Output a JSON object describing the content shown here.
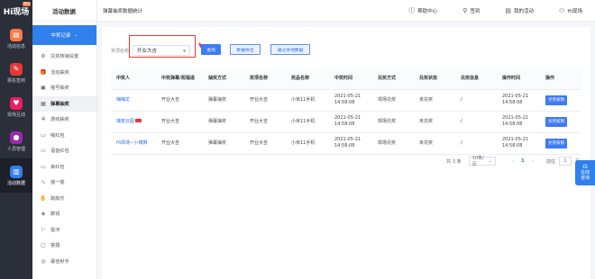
{
  "brand": {
    "logo_text": "Hi现场",
    "badge": "测试"
  },
  "rail": [
    {
      "label": "活动信息",
      "icon": "briefcase-icon",
      "color": "#ff7a45"
    },
    {
      "label": "报名签到",
      "icon": "checkin-icon",
      "color": "#e53935"
    },
    {
      "label": "现场互动",
      "icon": "interaction-icon",
      "color": "#e91e63"
    },
    {
      "label": "人员管理",
      "icon": "user-icon",
      "color": "#9c27b0"
    },
    {
      "label": "活动数据",
      "icon": "chart-icon",
      "color": "#2f80ed"
    }
  ],
  "sidebar": {
    "title": "活动数据",
    "group": "中奖记录",
    "items": [
      {
        "label": "兑奖核销设置",
        "icon": "settings-icon"
      },
      {
        "label": "活动抽奖",
        "icon": "gift-icon"
      },
      {
        "label": "摇号抽奖",
        "icon": "dice-icon"
      },
      {
        "label": "弹幕抽奖",
        "icon": "danmaku-icon"
      },
      {
        "label": "游戏抽奖",
        "icon": "game-icon"
      },
      {
        "label": "喊红包",
        "icon": "redpacket-icon"
      },
      {
        "label": "语音红包",
        "icon": "voice-redpacket-icon"
      },
      {
        "label": "拿红包",
        "icon": "grab-redpacket-icon"
      },
      {
        "label": "摇一摇",
        "icon": "shake-icon"
      },
      {
        "label": "敲敲乐",
        "icon": "knock-icon"
      },
      {
        "label": "数钱",
        "icon": "money-icon"
      },
      {
        "label": "拔河",
        "icon": "tug-icon"
      },
      {
        "label": "答题",
        "icon": "quiz-icon"
      },
      {
        "label": "最佳射手",
        "icon": "shooter-icon"
      }
    ]
  },
  "topbar": {
    "breadcrumb": "弹幕抽奖数据统计",
    "help": "帮助中心",
    "checkin": "签到",
    "my_activity": "我的活动",
    "user": "Hi现场"
  },
  "filter": {
    "label": "奖项名称",
    "selected": "开业大吉",
    "query_button": "查询",
    "export_button": "数据导出",
    "sync_button": "通过本地数据"
  },
  "table": {
    "headers": [
      "中奖人",
      "中奖弹幕/祝福语",
      "抽奖方式",
      "奖项名称",
      "奖品名称",
      "中奖时间",
      "兑奖方式",
      "兑奖状态",
      "兑奖信息",
      "操作时间",
      "操作"
    ],
    "rows": [
      {
        "winner": "嗨嗨龙",
        "bless": "开业大吉",
        "method": "弹幕抽奖",
        "award": "开业大吉",
        "prize": "小米11手机",
        "time": "2021-05-21 14:58:08",
        "redeem_method": "现场兑奖",
        "status": "未兑奖",
        "info": "/",
        "op_time": "2021-05-21 14:58:08",
        "action": "兑奖核销"
      },
      {
        "winner": "瑞普云图",
        "bless": "开业大吉",
        "method": "弹幕抽奖",
        "award": "开业大吉",
        "prize": "小米11手机",
        "time": "2021-05-21 14:58:08",
        "redeem_method": "现场兑奖",
        "status": "未兑奖",
        "info": "/",
        "op_time": "2021-05-21 14:58:08",
        "action": "兑奖核销"
      },
      {
        "winner": "Hi现场~小博狮",
        "bless": "开业大吉",
        "method": "弹幕抽奖",
        "award": "开业大吉",
        "prize": "小米11手机",
        "time": "2021-05-21 14:58:08",
        "redeem_method": "现场兑奖",
        "status": "未兑奖",
        "info": "/",
        "op_time": "2021-05-21 14:58:08",
        "action": "兑奖核销"
      }
    ]
  },
  "pager": {
    "total": "共 3 条",
    "page_size": "10条/页",
    "current": "1",
    "goto_label": "前往",
    "goto_value": "1",
    "page_suffix": "页"
  },
  "float": {
    "line1": "在线",
    "line2": "咨询"
  },
  "colors": {
    "primary": "#2f80ed",
    "highlight": "#e53935",
    "rail_bg": "#2b2f3a"
  }
}
